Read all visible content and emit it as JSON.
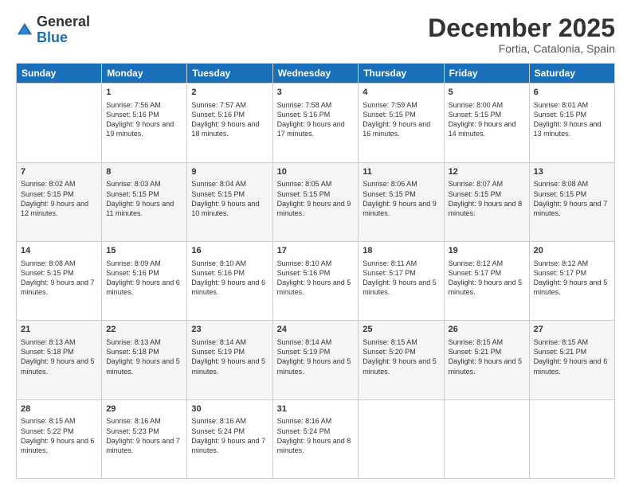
{
  "header": {
    "logo": {
      "general": "General",
      "blue": "Blue"
    },
    "title": "December 2025",
    "location": "Fortia, Catalonia, Spain"
  },
  "calendar": {
    "days_of_week": [
      "Sunday",
      "Monday",
      "Tuesday",
      "Wednesday",
      "Thursday",
      "Friday",
      "Saturday"
    ],
    "weeks": [
      [
        {
          "day": "",
          "sunrise": "",
          "sunset": "",
          "daylight": ""
        },
        {
          "day": "1",
          "sunrise": "Sunrise: 7:56 AM",
          "sunset": "Sunset: 5:16 PM",
          "daylight": "Daylight: 9 hours and 19 minutes."
        },
        {
          "day": "2",
          "sunrise": "Sunrise: 7:57 AM",
          "sunset": "Sunset: 5:16 PM",
          "daylight": "Daylight: 9 hours and 18 minutes."
        },
        {
          "day": "3",
          "sunrise": "Sunrise: 7:58 AM",
          "sunset": "Sunset: 5:16 PM",
          "daylight": "Daylight: 9 hours and 17 minutes."
        },
        {
          "day": "4",
          "sunrise": "Sunrise: 7:59 AM",
          "sunset": "Sunset: 5:15 PM",
          "daylight": "Daylight: 9 hours and 16 minutes."
        },
        {
          "day": "5",
          "sunrise": "Sunrise: 8:00 AM",
          "sunset": "Sunset: 5:15 PM",
          "daylight": "Daylight: 9 hours and 14 minutes."
        },
        {
          "day": "6",
          "sunrise": "Sunrise: 8:01 AM",
          "sunset": "Sunset: 5:15 PM",
          "daylight": "Daylight: 9 hours and 13 minutes."
        }
      ],
      [
        {
          "day": "7",
          "sunrise": "Sunrise: 8:02 AM",
          "sunset": "Sunset: 5:15 PM",
          "daylight": "Daylight: 9 hours and 12 minutes."
        },
        {
          "day": "8",
          "sunrise": "Sunrise: 8:03 AM",
          "sunset": "Sunset: 5:15 PM",
          "daylight": "Daylight: 9 hours and 11 minutes."
        },
        {
          "day": "9",
          "sunrise": "Sunrise: 8:04 AM",
          "sunset": "Sunset: 5:15 PM",
          "daylight": "Daylight: 9 hours and 10 minutes."
        },
        {
          "day": "10",
          "sunrise": "Sunrise: 8:05 AM",
          "sunset": "Sunset: 5:15 PM",
          "daylight": "Daylight: 9 hours and 9 minutes."
        },
        {
          "day": "11",
          "sunrise": "Sunrise: 8:06 AM",
          "sunset": "Sunset: 5:15 PM",
          "daylight": "Daylight: 9 hours and 9 minutes."
        },
        {
          "day": "12",
          "sunrise": "Sunrise: 8:07 AM",
          "sunset": "Sunset: 5:15 PM",
          "daylight": "Daylight: 9 hours and 8 minutes."
        },
        {
          "day": "13",
          "sunrise": "Sunrise: 8:08 AM",
          "sunset": "Sunset: 5:15 PM",
          "daylight": "Daylight: 9 hours and 7 minutes."
        }
      ],
      [
        {
          "day": "14",
          "sunrise": "Sunrise: 8:08 AM",
          "sunset": "Sunset: 5:15 PM",
          "daylight": "Daylight: 9 hours and 7 minutes."
        },
        {
          "day": "15",
          "sunrise": "Sunrise: 8:09 AM",
          "sunset": "Sunset: 5:16 PM",
          "daylight": "Daylight: 9 hours and 6 minutes."
        },
        {
          "day": "16",
          "sunrise": "Sunrise: 8:10 AM",
          "sunset": "Sunset: 5:16 PM",
          "daylight": "Daylight: 9 hours and 6 minutes."
        },
        {
          "day": "17",
          "sunrise": "Sunrise: 8:10 AM",
          "sunset": "Sunset: 5:16 PM",
          "daylight": "Daylight: 9 hours and 5 minutes."
        },
        {
          "day": "18",
          "sunrise": "Sunrise: 8:11 AM",
          "sunset": "Sunset: 5:17 PM",
          "daylight": "Daylight: 9 hours and 5 minutes."
        },
        {
          "day": "19",
          "sunrise": "Sunrise: 8:12 AM",
          "sunset": "Sunset: 5:17 PM",
          "daylight": "Daylight: 9 hours and 5 minutes."
        },
        {
          "day": "20",
          "sunrise": "Sunrise: 8:12 AM",
          "sunset": "Sunset: 5:17 PM",
          "daylight": "Daylight: 9 hours and 5 minutes."
        }
      ],
      [
        {
          "day": "21",
          "sunrise": "Sunrise: 8:13 AM",
          "sunset": "Sunset: 5:18 PM",
          "daylight": "Daylight: 9 hours and 5 minutes."
        },
        {
          "day": "22",
          "sunrise": "Sunrise: 8:13 AM",
          "sunset": "Sunset: 5:18 PM",
          "daylight": "Daylight: 9 hours and 5 minutes."
        },
        {
          "day": "23",
          "sunrise": "Sunrise: 8:14 AM",
          "sunset": "Sunset: 5:19 PM",
          "daylight": "Daylight: 9 hours and 5 minutes."
        },
        {
          "day": "24",
          "sunrise": "Sunrise: 8:14 AM",
          "sunset": "Sunset: 5:19 PM",
          "daylight": "Daylight: 9 hours and 5 minutes."
        },
        {
          "day": "25",
          "sunrise": "Sunrise: 8:15 AM",
          "sunset": "Sunset: 5:20 PM",
          "daylight": "Daylight: 9 hours and 5 minutes."
        },
        {
          "day": "26",
          "sunrise": "Sunrise: 8:15 AM",
          "sunset": "Sunset: 5:21 PM",
          "daylight": "Daylight: 9 hours and 5 minutes."
        },
        {
          "day": "27",
          "sunrise": "Sunrise: 8:15 AM",
          "sunset": "Sunset: 5:21 PM",
          "daylight": "Daylight: 9 hours and 6 minutes."
        }
      ],
      [
        {
          "day": "28",
          "sunrise": "Sunrise: 8:15 AM",
          "sunset": "Sunset: 5:22 PM",
          "daylight": "Daylight: 9 hours and 6 minutes."
        },
        {
          "day": "29",
          "sunrise": "Sunrise: 8:16 AM",
          "sunset": "Sunset: 5:23 PM",
          "daylight": "Daylight: 9 hours and 7 minutes."
        },
        {
          "day": "30",
          "sunrise": "Sunrise: 8:16 AM",
          "sunset": "Sunset: 5:24 PM",
          "daylight": "Daylight: 9 hours and 7 minutes."
        },
        {
          "day": "31",
          "sunrise": "Sunrise: 8:16 AM",
          "sunset": "Sunset: 5:24 PM",
          "daylight": "Daylight: 9 hours and 8 minutes."
        },
        {
          "day": "",
          "sunrise": "",
          "sunset": "",
          "daylight": ""
        },
        {
          "day": "",
          "sunrise": "",
          "sunset": "",
          "daylight": ""
        },
        {
          "day": "",
          "sunrise": "",
          "sunset": "",
          "daylight": ""
        }
      ]
    ]
  }
}
